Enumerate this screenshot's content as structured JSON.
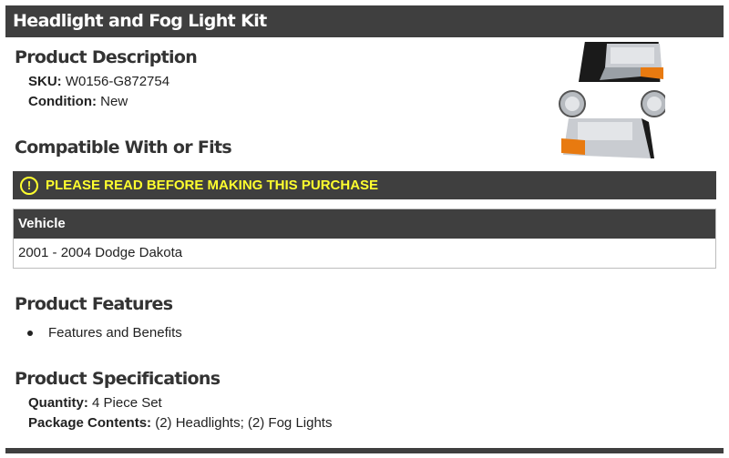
{
  "title": "Headlight and Fog Light Kit",
  "product_description": {
    "heading": "Product Description",
    "sku_label": "SKU:",
    "sku_value": "W0156-G872754",
    "condition_label": "Condition:",
    "condition_value": "New"
  },
  "compatibility": {
    "heading": "Compatible With or Fits",
    "notice_icon": "!",
    "notice": "PLEASE READ BEFORE MAKING THIS PURCHASE",
    "table_header": "Vehicle",
    "rows": [
      "2001 - 2004 Dodge Dakota"
    ]
  },
  "features": {
    "heading": "Product Features",
    "items": [
      "Features and Benefits"
    ]
  },
  "specifications": {
    "heading": "Product Specifications",
    "quantity_label": "Quantity:",
    "quantity_value": "4 Piece Set",
    "contents_label": "Package Contents:",
    "contents_value": "(2) Headlights; (2) Fog Lights"
  },
  "colors": {
    "bar": "#3f3f3f",
    "notice_text": "#ffff2e",
    "amber": "#e87a10"
  }
}
